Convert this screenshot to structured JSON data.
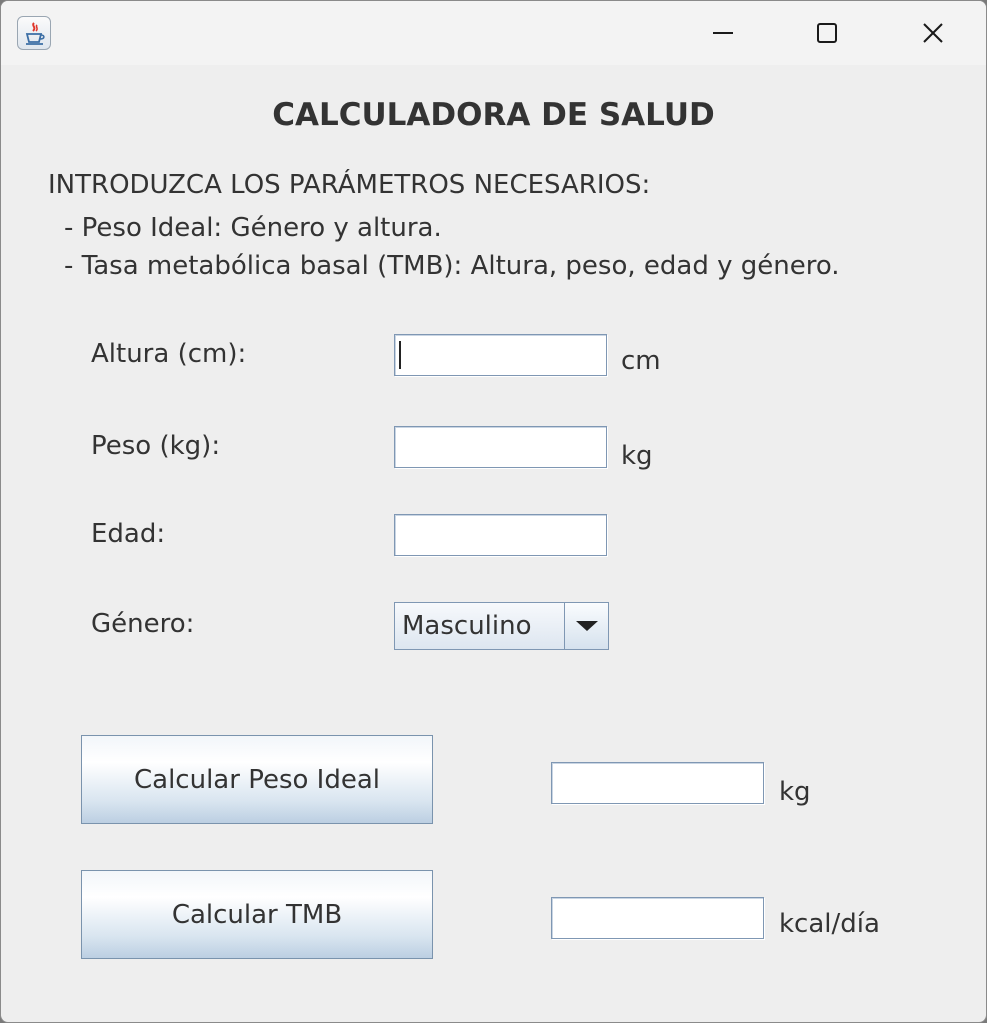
{
  "window": {
    "app_icon": "java-coffee-cup-icon",
    "controls": [
      "minimize-icon",
      "maximize-icon",
      "close-icon"
    ]
  },
  "title": "CALCULADORA DE SALUD",
  "instructions": {
    "heading": "INTRODUZCA LOS PARÁMETROS NECESARIOS:",
    "line1": "- Peso Ideal: Género y altura.",
    "line2": "- Tasa metabólica basal (TMB): Altura, peso, edad y género."
  },
  "form": {
    "height_label": "Altura (cm):",
    "height_value": "",
    "height_unit": "cm",
    "weight_label": "Peso (kg):",
    "weight_value": "",
    "weight_unit": "kg",
    "age_label": "Edad:",
    "age_value": "",
    "gender_label": "Género:",
    "gender_selected": "Masculino"
  },
  "actions": {
    "ideal_weight_button": "Calcular Peso Ideal",
    "ideal_weight_result": "",
    "ideal_weight_unit": "kg",
    "bmr_button": "Calcular TMB",
    "bmr_result": "",
    "bmr_unit": "kcal/día"
  }
}
